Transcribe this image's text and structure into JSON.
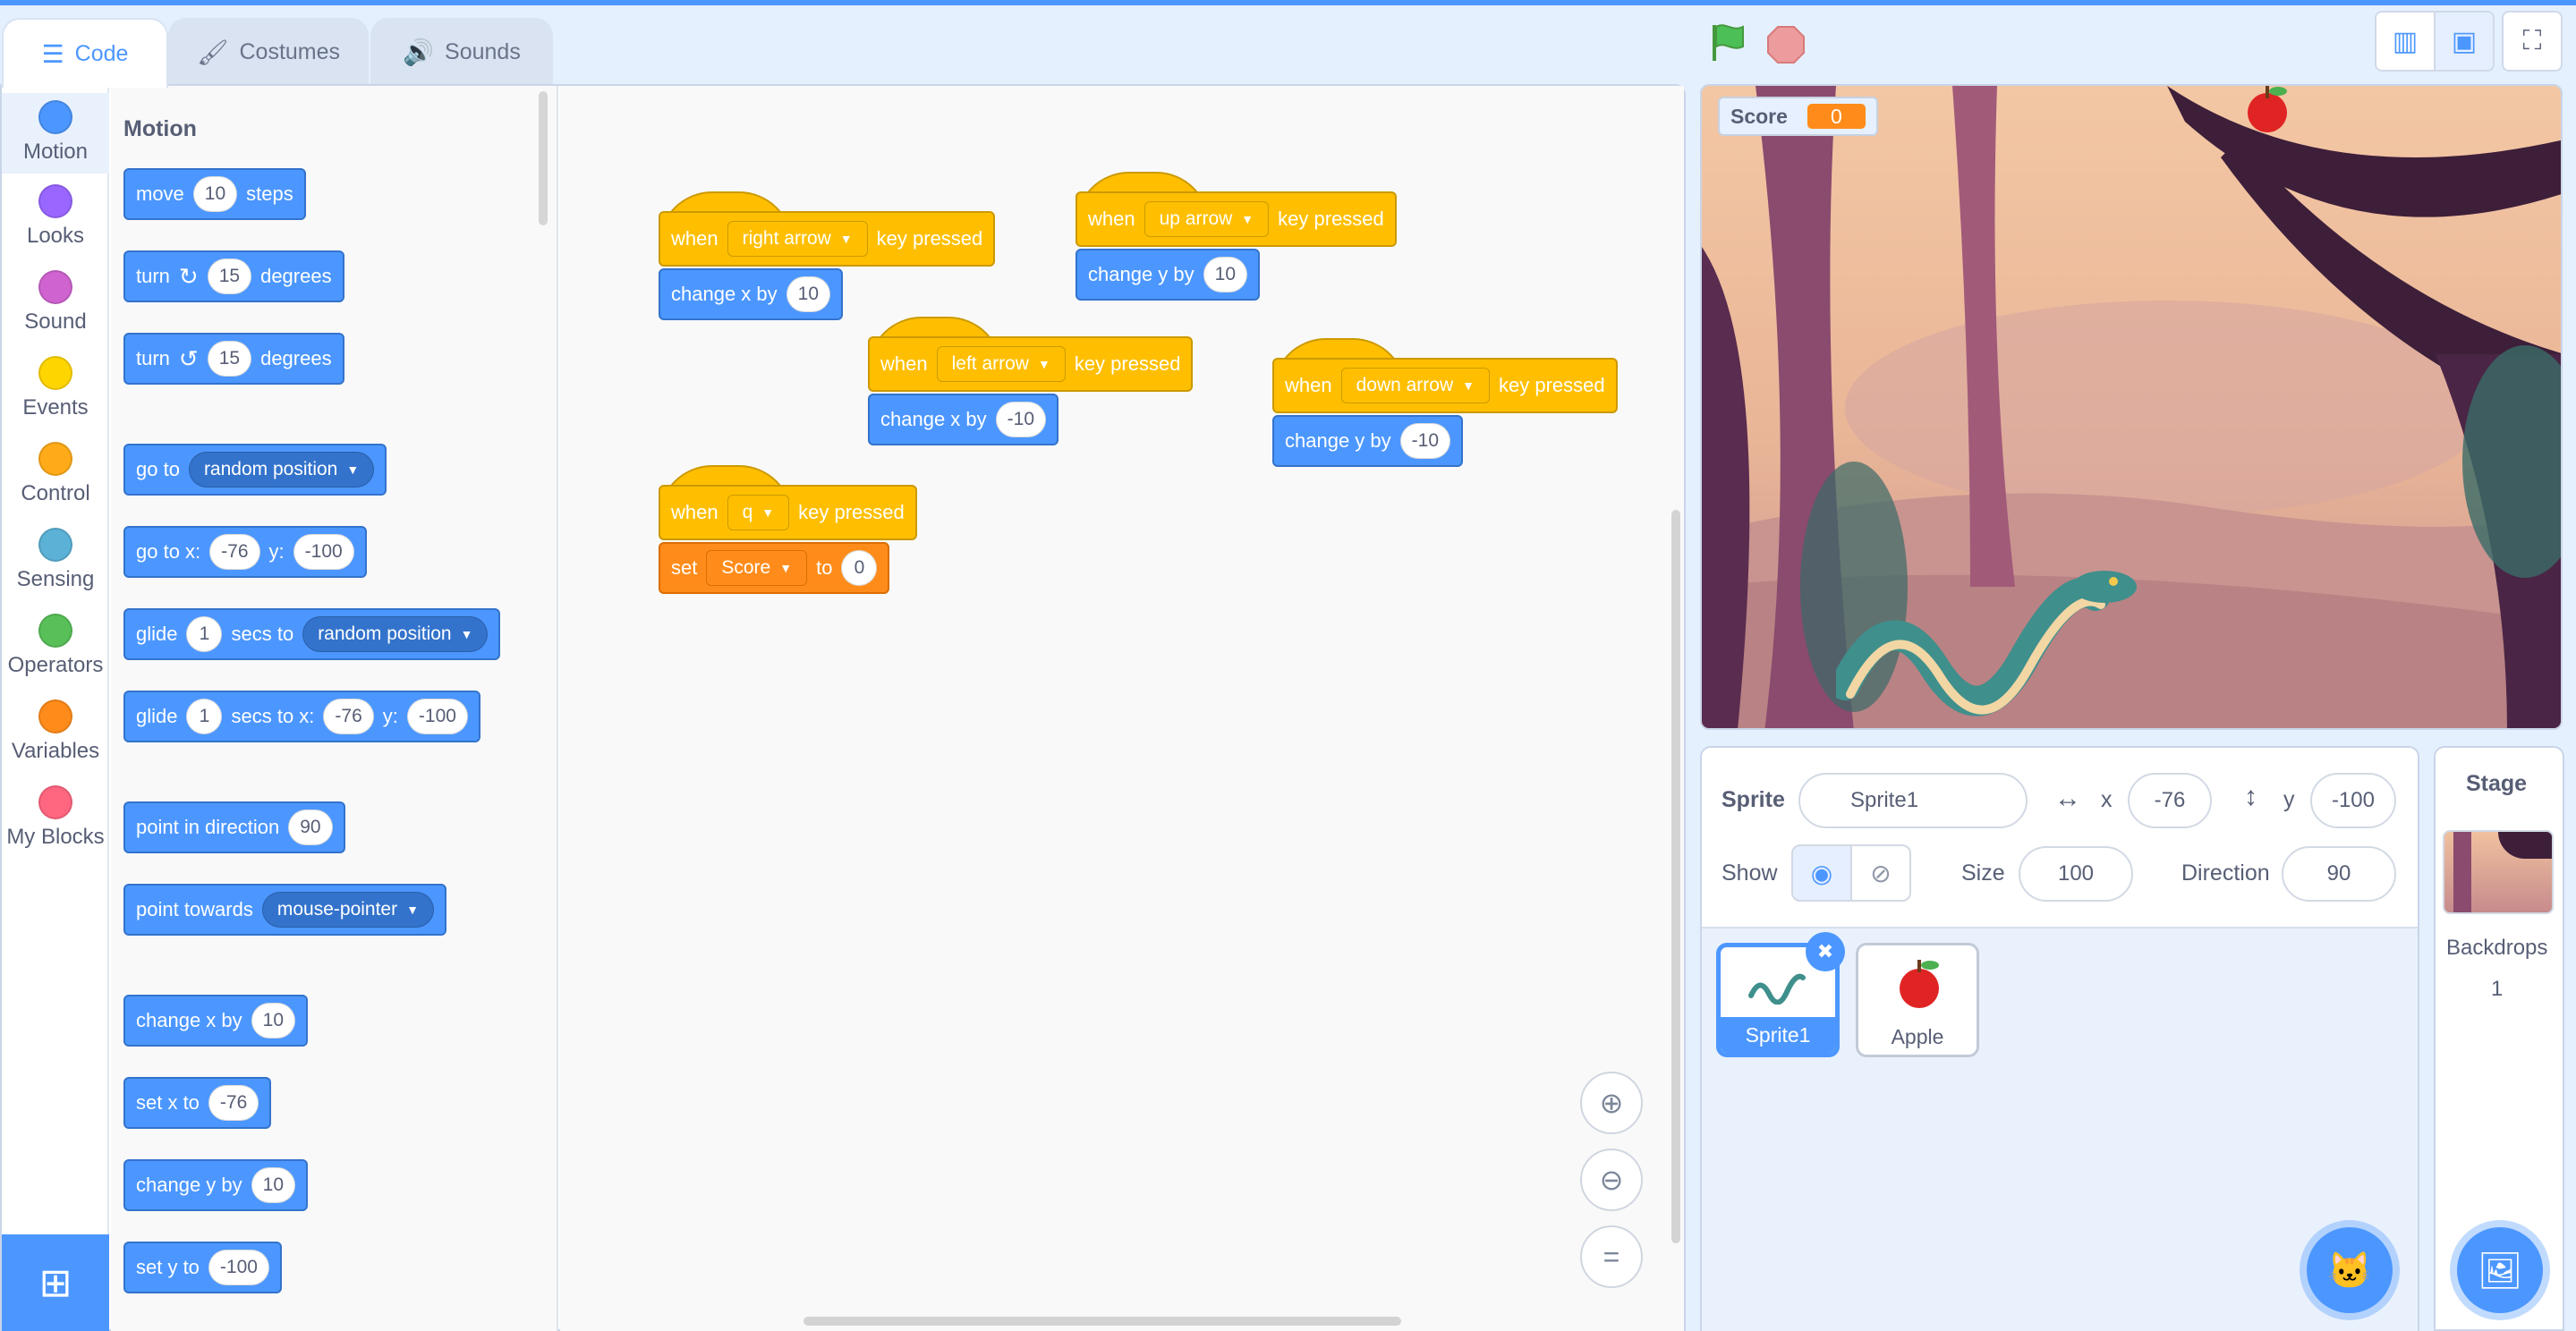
{
  "tabs": [
    {
      "label": "Code",
      "icon": "code-icon"
    },
    {
      "label": "Costumes",
      "icon": "brush-icon"
    },
    {
      "label": "Sounds",
      "icon": "speaker-icon"
    }
  ],
  "categories": [
    {
      "label": "Motion",
      "color": "#4c97ff"
    },
    {
      "label": "Looks",
      "color": "#9966ff"
    },
    {
      "label": "Sound",
      "color": "#cf63cf"
    },
    {
      "label": "Events",
      "color": "#ffd500"
    },
    {
      "label": "Control",
      "color": "#ffab19"
    },
    {
      "label": "Sensing",
      "color": "#5cb1d6"
    },
    {
      "label": "Operators",
      "color": "#59c059"
    },
    {
      "label": "Variables",
      "color": "#ff8c1a"
    },
    {
      "label": "My Blocks",
      "color": "#ff6680"
    }
  ],
  "palette": {
    "section_title": "Motion",
    "move": {
      "a": "move",
      "v": "10",
      "b": "steps"
    },
    "turn_cw": {
      "a": "turn",
      "v": "15",
      "b": "degrees"
    },
    "turn_ccw": {
      "a": "turn",
      "v": "15",
      "b": "degrees"
    },
    "goto": {
      "a": "go to",
      "opt": "random position"
    },
    "gotoxy": {
      "a": "go to x:",
      "x": "-76",
      "b": "y:",
      "y": "-100"
    },
    "glide": {
      "a": "glide",
      "v": "1",
      "b": "secs to",
      "opt": "random position"
    },
    "glidexy": {
      "a": "glide",
      "v": "1",
      "b": "secs to x:",
      "x": "-76",
      "c": "y:",
      "y": "-100"
    },
    "point_dir": {
      "a": "point in direction",
      "v": "90"
    },
    "point_towards": {
      "a": "point towards",
      "opt": "mouse-pointer"
    },
    "change_x": {
      "a": "change x by",
      "v": "10"
    },
    "set_x": {
      "a": "set x to",
      "v": "-76"
    },
    "change_y": {
      "a": "change y by",
      "v": "10"
    },
    "set_y": {
      "a": "set y to",
      "v": "-100"
    }
  },
  "scripts": {
    "s1": {
      "when": "when",
      "key": "right arrow",
      "pressed": "key pressed",
      "action": "change x by",
      "v": "10"
    },
    "s2": {
      "when": "when",
      "key": "up arrow",
      "pressed": "key pressed",
      "action": "change y by",
      "v": "10"
    },
    "s3": {
      "when": "when",
      "key": "left arrow",
      "pressed": "key pressed",
      "action": "change x by",
      "v": "-10"
    },
    "s4": {
      "when": "when",
      "key": "down arrow",
      "pressed": "key pressed",
      "action": "change y by",
      "v": "-10"
    },
    "s5": {
      "when": "when",
      "key": "q",
      "pressed": "key pressed",
      "action": "set",
      "var": "Score",
      "to": "to",
      "v": "0"
    }
  },
  "stage": {
    "monitor_label": "Score",
    "monitor_value": "0"
  },
  "sprite_info": {
    "sprite_label": "Sprite",
    "sprite_name": "Sprite1",
    "x_label": "x",
    "x": "-76",
    "y_label": "y",
    "y": "-100",
    "show_label": "Show",
    "size_label": "Size",
    "size": "100",
    "direction_label": "Direction",
    "direction": "90"
  },
  "sprites": [
    {
      "name": "Sprite1",
      "selected": true
    },
    {
      "name": "Apple",
      "selected": false
    }
  ],
  "stage_target": {
    "label": "Stage",
    "backdrops_label": "Backdrops",
    "backdrops_count": "1"
  }
}
